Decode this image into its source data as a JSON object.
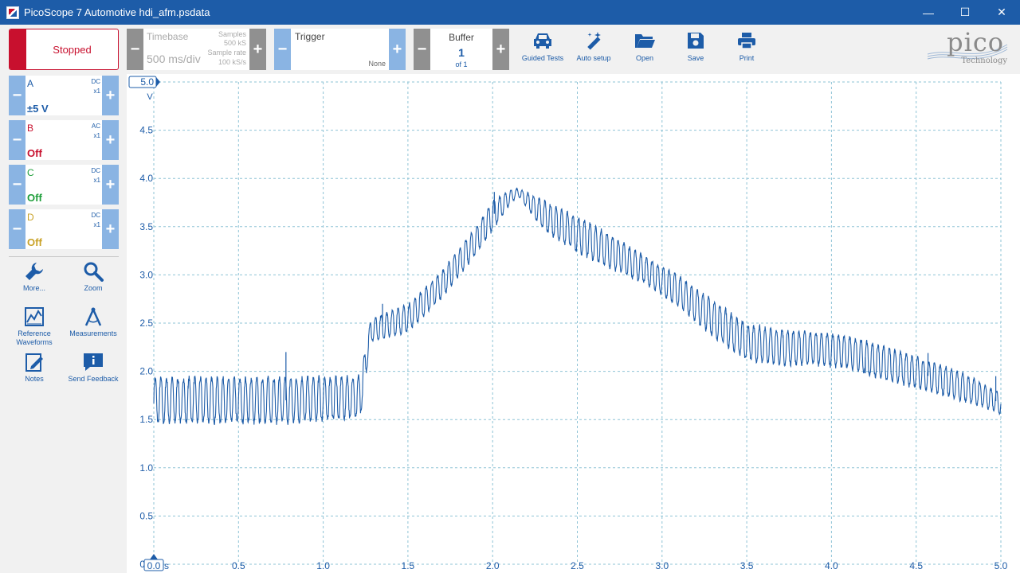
{
  "window": {
    "title": "PicoScope 7 Automotive hdi_afm.psdata",
    "minimize": "—",
    "maximize": "☐",
    "close": "✕"
  },
  "toolbar": {
    "run_state": "Stopped",
    "timebase": {
      "title": "Timebase",
      "value": "500 ms/div",
      "samples_label": "Samples",
      "samples_value": "500 kS",
      "rate_label": "Sample rate",
      "rate_value": "100 kS/s",
      "minus": "−",
      "plus": "+"
    },
    "trigger": {
      "title": "Trigger",
      "value": "None",
      "minus": "−",
      "plus": "+"
    },
    "buffer": {
      "title": "Buffer",
      "value": "1",
      "of": "of 1",
      "minus": "−",
      "plus": "+"
    },
    "tools": [
      {
        "label": "Guided Tests",
        "icon": "car-icon"
      },
      {
        "label": "Auto setup",
        "icon": "wand-icon"
      },
      {
        "label": "Open",
        "icon": "folder-open-icon"
      },
      {
        "label": "Save",
        "icon": "save-icon"
      },
      {
        "label": "Print",
        "icon": "printer-icon"
      }
    ],
    "logo": {
      "word": "pico",
      "sub": "Technology"
    }
  },
  "channels": [
    {
      "name": "A",
      "coupling": "DC",
      "probe": "x1",
      "range": "±5 V",
      "color": "#1d5ca8",
      "minus": "−",
      "plus": "+"
    },
    {
      "name": "B",
      "coupling": "AC",
      "probe": "x1",
      "range": "Off",
      "color": "#c8102e",
      "minus": "−",
      "plus": "+"
    },
    {
      "name": "C",
      "coupling": "DC",
      "probe": "x1",
      "range": "Off",
      "color": "#1e9e3a",
      "minus": "−",
      "plus": "+"
    },
    {
      "name": "D",
      "coupling": "DC",
      "probe": "x1",
      "range": "Off",
      "color": "#c9a227",
      "minus": "−",
      "plus": "+"
    }
  ],
  "side_tools": [
    {
      "label": "More...",
      "icon": "wrench-icon"
    },
    {
      "label": "Zoom",
      "icon": "magnifier-icon"
    },
    {
      "label": "Reference Waveforms",
      "icon": "reference-waveform-icon"
    },
    {
      "label": "Measurements",
      "icon": "measurements-icon"
    },
    {
      "label": "Notes",
      "icon": "notes-icon"
    },
    {
      "label": "Send Feedback",
      "icon": "feedback-icon"
    }
  ],
  "chart_data": {
    "type": "line",
    "xlabel": "",
    "x_unit": "s",
    "ylabel": "V",
    "xlim": [
      0,
      5
    ],
    "ylim": [
      0,
      5
    ],
    "x_ticks": [
      "0.0",
      "0.5",
      "1.0",
      "1.5",
      "2.0",
      "2.5",
      "3.0",
      "3.5",
      "4.0",
      "4.5",
      "5.0"
    ],
    "y_ticks": [
      "0.0",
      "0.5",
      "1.0",
      "1.5",
      "2.0",
      "2.5",
      "3.0",
      "3.5",
      "4.0",
      "4.5",
      "5.0"
    ],
    "y_top_marker": "5.0",
    "x_start_marker": "0.0",
    "grid": true,
    "series": [
      {
        "color": "#1d5ca8",
        "envelope": {
          "x": [
            0.0,
            0.4,
            0.8,
            1.22,
            1.28,
            1.5,
            1.7,
            1.9,
            2.0,
            2.1,
            2.15,
            2.3,
            2.5,
            2.7,
            2.9,
            3.1,
            3.3,
            3.5,
            3.7,
            3.9,
            4.1,
            4.3,
            4.5,
            4.7,
            4.9,
            5.0
          ],
          "upper": [
            1.95,
            1.95,
            1.95,
            1.97,
            2.55,
            2.7,
            3.05,
            3.5,
            3.78,
            3.88,
            3.9,
            3.78,
            3.62,
            3.42,
            3.2,
            3.0,
            2.75,
            2.5,
            2.45,
            2.42,
            2.38,
            2.28,
            2.16,
            2.05,
            1.88,
            1.78
          ],
          "lower": [
            1.45,
            1.45,
            1.45,
            1.5,
            2.3,
            2.4,
            2.75,
            3.2,
            3.45,
            3.72,
            3.82,
            3.45,
            3.22,
            3.05,
            2.9,
            2.65,
            2.35,
            2.1,
            2.05,
            2.05,
            2.02,
            1.9,
            1.82,
            1.72,
            1.62,
            1.55
          ]
        },
        "ripple_frequency_hz": 30,
        "spikes": [
          {
            "x": 0.78,
            "y": 2.2
          },
          {
            "x": 1.35,
            "y": 2.7
          },
          {
            "x": 2.01,
            "y": 3.86
          },
          {
            "x": 4.2,
            "y": 1.98
          },
          {
            "x": 4.57,
            "y": 2.19
          },
          {
            "x": 4.97,
            "y": 1.95
          }
        ]
      }
    ]
  }
}
